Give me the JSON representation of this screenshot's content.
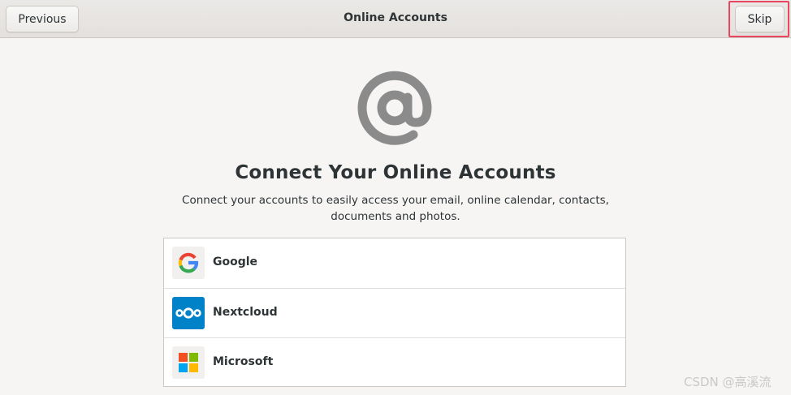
{
  "header": {
    "title": "Online Accounts",
    "previous_label": "Previous",
    "skip_label": "Skip"
  },
  "main": {
    "hero_icon": "at-sign-icon",
    "heading": "Connect Your Online Accounts",
    "description": "Connect your accounts to easily access your email, online calendar, contacts, documents and photos.",
    "providers": [
      {
        "label": "Google",
        "icon": "google-icon"
      },
      {
        "label": "Nextcloud",
        "icon": "nextcloud-icon"
      },
      {
        "label": "Microsoft",
        "icon": "microsoft-icon"
      }
    ]
  },
  "watermark": "CSDN @高溪流",
  "colors": {
    "highlight": "#e8475f",
    "nextcloud": "#0082c9",
    "icon_gray": "#8b8b8b"
  }
}
